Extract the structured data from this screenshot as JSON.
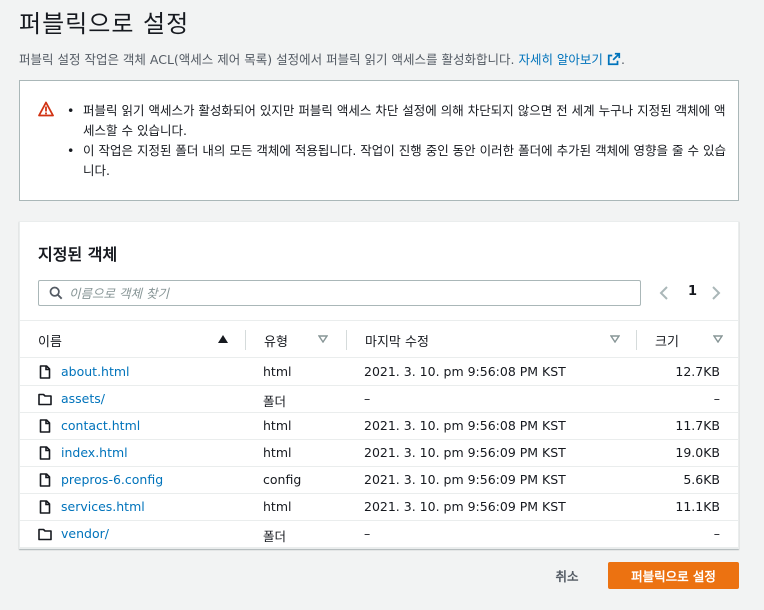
{
  "page": {
    "title": "퍼블릭으로 설정",
    "description": "퍼블릭 설정 작업은 객체 ACL(액세스 제어 목록) 설정에서 퍼블릭 읽기 액세스를 활성화합니다.",
    "learn_more": "자세히 알아보기",
    "trailing_period": "."
  },
  "alert": {
    "icon": "warning-icon",
    "items": [
      "퍼블릭 읽기 액세스가 활성화되어 있지만 퍼블릭 액세스 차단 설정에 의해 차단되지 않으면 전 세계 누구나 지정된 객체에 액세스할 수 있습니다.",
      "이 작업은 지정된 폴더 내의 모든 객체에 적용됩니다. 작업이 진행 중인 동안 이러한 폴더에 추가된 객체에 영향을 줄 수 있습니다."
    ]
  },
  "objects": {
    "title": "지정된 객체",
    "search_placeholder": "이름으로 객체 찾기",
    "page_number": "1",
    "columns": {
      "name": "이름",
      "type": "유형",
      "modified": "마지막 수정",
      "size": "크기"
    },
    "rows": [
      {
        "name": "about.html",
        "kind": "file",
        "type": "html",
        "modified": "2021. 3. 10. pm 9:56:08 PM KST",
        "size": "12.7KB"
      },
      {
        "name": "assets/",
        "kind": "folder",
        "type": "폴더",
        "modified": "–",
        "size": "–"
      },
      {
        "name": "contact.html",
        "kind": "file",
        "type": "html",
        "modified": "2021. 3. 10. pm 9:56:08 PM KST",
        "size": "11.7KB"
      },
      {
        "name": "index.html",
        "kind": "file",
        "type": "html",
        "modified": "2021. 3. 10. pm 9:56:09 PM KST",
        "size": "19.0KB"
      },
      {
        "name": "prepros-6.config",
        "kind": "file",
        "type": "config",
        "modified": "2021. 3. 10. pm 9:56:09 PM KST",
        "size": "5.6KB"
      },
      {
        "name": "services.html",
        "kind": "file",
        "type": "html",
        "modified": "2021. 3. 10. pm 9:56:09 PM KST",
        "size": "11.1KB"
      },
      {
        "name": "vendor/",
        "kind": "folder",
        "type": "폴더",
        "modified": "–",
        "size": "–"
      }
    ]
  },
  "footer": {
    "cancel_label": "취소",
    "confirm_label": "퍼블릭으로 설정"
  },
  "colors": {
    "accent": "#ec7211",
    "link": "#0073bb",
    "warning": "#d13212"
  }
}
